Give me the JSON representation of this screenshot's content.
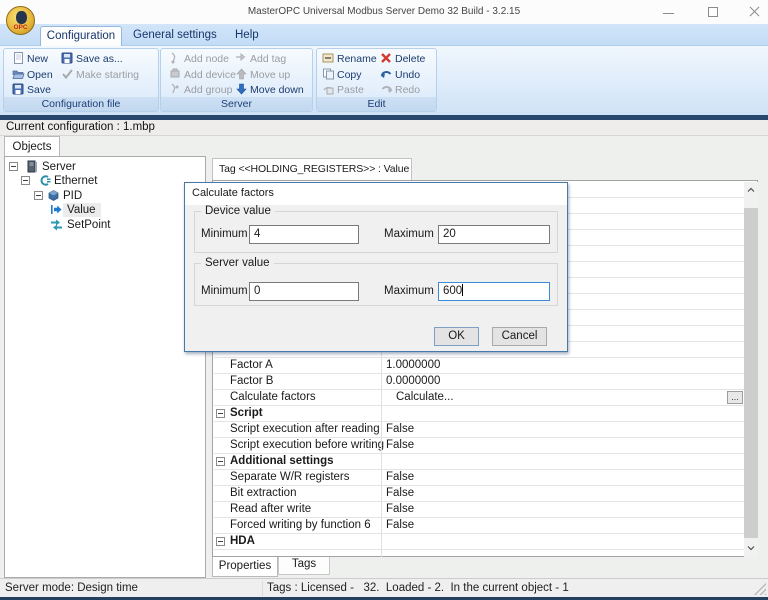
{
  "window": {
    "title": "MasterOPC Universal Modbus Server Demo 32 Build - 3.2.15"
  },
  "menu_tabs": [
    {
      "label": "Configuration",
      "active": true
    },
    {
      "label": "General settings",
      "active": false
    },
    {
      "label": "Help",
      "active": false
    }
  ],
  "ribbon": {
    "groups": [
      {
        "label": "Configuration file",
        "buttons": [
          {
            "label": "New",
            "icon": "new-file-icon",
            "enabled": true
          },
          {
            "label": "Save as...",
            "icon": "save-as-icon",
            "enabled": true
          },
          {
            "label": "Open",
            "icon": "open-icon",
            "enabled": true
          },
          {
            "label": "Make starting",
            "icon": "make-starting-icon",
            "enabled": false
          },
          {
            "label": "Save",
            "icon": "save-icon",
            "enabled": true
          }
        ]
      },
      {
        "label": "Server",
        "buttons": [
          {
            "label": "Add node",
            "icon": "add-node-icon",
            "enabled": false
          },
          {
            "label": "Add tag",
            "icon": "add-tag-icon",
            "enabled": false
          },
          {
            "label": "Add device",
            "icon": "add-device-icon",
            "enabled": false
          },
          {
            "label": "Move up",
            "icon": "move-up-icon",
            "enabled": false
          },
          {
            "label": "Add group",
            "icon": "add-group-icon",
            "enabled": false
          },
          {
            "label": "Move down",
            "icon": "move-down-icon",
            "enabled": true
          }
        ]
      },
      {
        "label": "Edit",
        "buttons": [
          {
            "label": "Rename",
            "icon": "rename-icon",
            "enabled": true
          },
          {
            "label": "Delete",
            "icon": "delete-icon",
            "enabled": true
          },
          {
            "label": "Copy",
            "icon": "copy-icon",
            "enabled": true
          },
          {
            "label": "Undo",
            "icon": "undo-icon",
            "enabled": true
          },
          {
            "label": "Paste",
            "icon": "paste-icon",
            "enabled": false
          },
          {
            "label": "Redo",
            "icon": "redo-icon",
            "enabled": false
          }
        ]
      }
    ]
  },
  "config_bar": {
    "text": "Current configuration : 1.mbp"
  },
  "objects_tab": {
    "label": "Objects"
  },
  "tree": {
    "items": [
      {
        "label": "Server",
        "icon": "server-icon",
        "depth": 0
      },
      {
        "label": "Ethernet",
        "icon": "ethernet-icon",
        "depth": 1
      },
      {
        "label": "PID",
        "icon": "device-icon",
        "depth": 2
      },
      {
        "label": "Value",
        "icon": "tag-value-icon",
        "depth": 3,
        "selected": true
      },
      {
        "label": "SetPoint",
        "icon": "tag-setpoint-icon",
        "depth": 3
      }
    ]
  },
  "right_panel": {
    "tab_label": "Tag <<HOLDING_REGISTERS>> : Value"
  },
  "property_grid": {
    "rows": [
      {
        "type": "prop",
        "name": "Factor A",
        "value": "1.0000000"
      },
      {
        "type": "prop",
        "name": "Factor B",
        "value": "0.0000000"
      },
      {
        "type": "prop",
        "name": "Calculate factors",
        "value": "Calculate...",
        "button": "..."
      },
      {
        "type": "group",
        "name": "Script",
        "value": ""
      },
      {
        "type": "prop",
        "name": "Script execution after reading",
        "value": "False"
      },
      {
        "type": "prop",
        "name": "Script execution before writing",
        "value": "False"
      },
      {
        "type": "group",
        "name": "Additional settings",
        "value": ""
      },
      {
        "type": "prop",
        "name": "Separate W/R registers",
        "value": "False"
      },
      {
        "type": "prop",
        "name": "Bit extraction",
        "value": "False"
      },
      {
        "type": "prop",
        "name": "Read after write",
        "value": "False"
      },
      {
        "type": "prop",
        "name": "Forced writing by function 6",
        "value": "False"
      },
      {
        "type": "group",
        "name": "HDA",
        "value": ""
      }
    ]
  },
  "dialog": {
    "title": "Calculate factors",
    "groups": [
      {
        "label": "Device value",
        "fields": [
          {
            "label": "Minimum",
            "value": "4"
          },
          {
            "label": "Maximum",
            "value": "20"
          }
        ]
      },
      {
        "label": "Server value",
        "fields": [
          {
            "label": "Minimum",
            "value": "0"
          },
          {
            "label": "Maximum",
            "value": "600",
            "focused": true
          }
        ]
      }
    ],
    "buttons": {
      "ok": "OK",
      "cancel": "Cancel"
    }
  },
  "bottom_tabs": [
    {
      "label": "Properties",
      "active": true
    },
    {
      "label": "Tags",
      "active": false
    }
  ],
  "status_bar": {
    "left": "Server mode: Design time",
    "center": "Tags : Licensed -   32.  Loaded - 2.  In the current object - 1"
  }
}
